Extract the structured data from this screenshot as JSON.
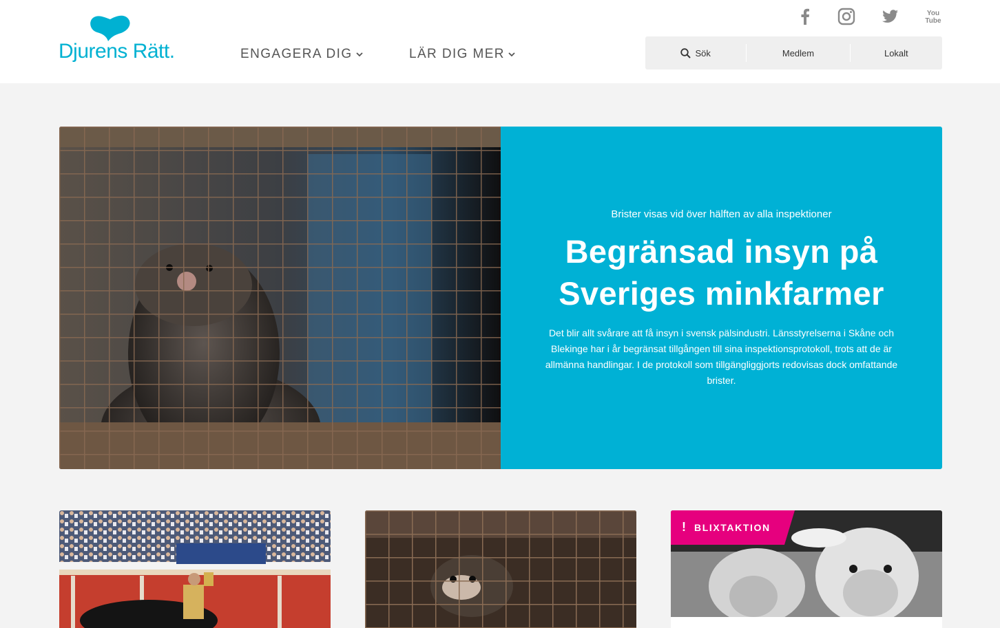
{
  "brand": {
    "name": "Djurens Rätt.",
    "color": "#00b1d2"
  },
  "nav": {
    "items": [
      {
        "label": "ENGAGERA DIG",
        "icon": "chevron-down-icon"
      },
      {
        "label": "LÄR DIG MER",
        "icon": "chevron-down-icon"
      }
    ]
  },
  "social": [
    "facebook-icon",
    "instagram-icon",
    "twitter-icon",
    "youtube-icon"
  ],
  "utility": {
    "search": "Sök",
    "member": "Medlem",
    "local": "Lokalt"
  },
  "hero": {
    "kicker": "Brister visas vid över hälften av alla inspektioner",
    "title_line1": "Begränsad insyn på",
    "title_line2": "Sveriges minkfarmer",
    "text": "Det blir allt svårare att få insyn i svensk pälsindustri. Länsstyrelserna i Skåne och Blekinge har i år begränsat tillgången till sina inspektionsprotokoll, trots att de är allmänna handlingar. I de protokoll som tillgängliggjorts redovisas dock omfattande brister.",
    "panel_color": "#00b1d5"
  },
  "cards": [
    {
      "image": "bullfight-photo"
    },
    {
      "image": "mink-cage-photo"
    },
    {
      "image": "sheep-photo",
      "badge": "BLIXTAKTION",
      "badge_icon": "exclamation-icon",
      "badge_color": "#e6007e"
    }
  ]
}
